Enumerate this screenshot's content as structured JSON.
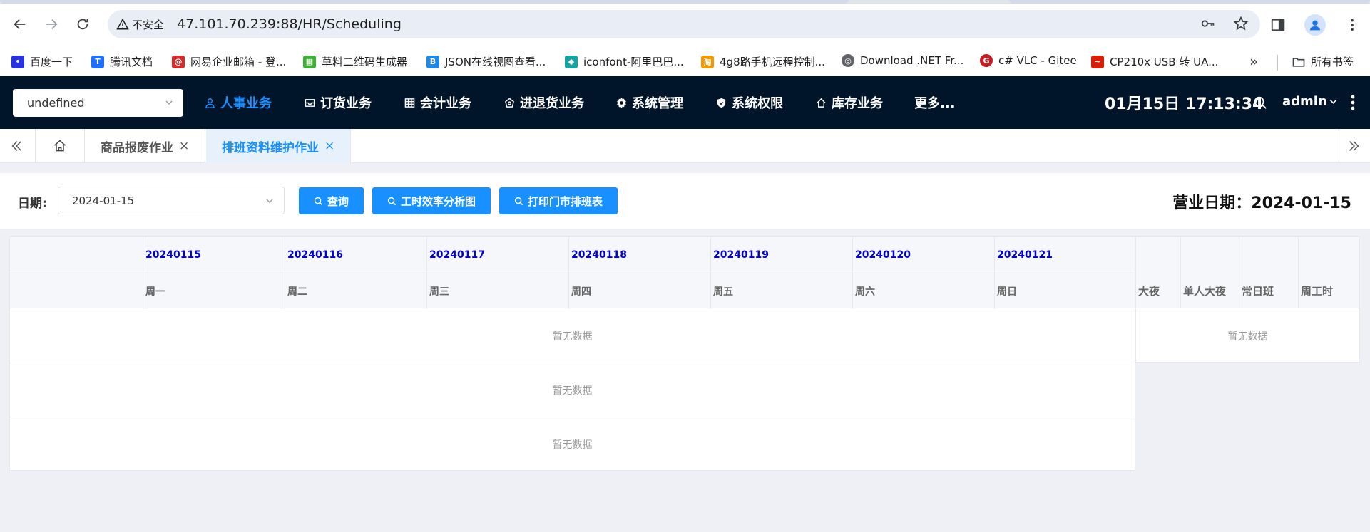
{
  "browser": {
    "security_label": "不安全",
    "url": "47.101.70.239:88/HR/Scheduling",
    "bookmarks": [
      {
        "label": "百度一下",
        "color": "#2932e1"
      },
      {
        "label": "腾讯文档",
        "color": "#1e6fff"
      },
      {
        "label": "网易企业邮箱 - 登...",
        "color": "#d52b2b"
      },
      {
        "label": "草料二维码生成器",
        "color": "#3cb034"
      },
      {
        "label": "JSON在线视图查看...",
        "color": "#1e88e5"
      },
      {
        "label": "iconfont-阿里巴巴...",
        "color": "#16a3a3"
      },
      {
        "label": "4g8路手机远程控制...",
        "color": "#f39800"
      },
      {
        "label": "Download .NET Fr...",
        "color": "#5f6368"
      },
      {
        "label": "c# VLC - Gitee",
        "color": "#c71d23"
      },
      {
        "label": "CP210x USB 转 UA...",
        "color": "#d81e06"
      }
    ],
    "all_bookmarks_label": "所有书签"
  },
  "header": {
    "org_select_value": "undefined",
    "menu": [
      {
        "label": "人事业务",
        "icon": "user-icon",
        "active": true
      },
      {
        "label": "订货业务",
        "icon": "mail-icon",
        "active": false
      },
      {
        "label": "会计业务",
        "icon": "table-icon",
        "active": false
      },
      {
        "label": "进退货业务",
        "icon": "shop-icon",
        "active": false
      },
      {
        "label": "系统管理",
        "icon": "gear-icon",
        "active": false
      },
      {
        "label": "系统权限",
        "icon": "shield-icon",
        "active": false
      },
      {
        "label": "库存业务",
        "icon": "home-icon",
        "active": false
      },
      {
        "label": "更多...",
        "icon": "",
        "active": false
      }
    ],
    "clock": "01月15日 17:13:34",
    "user": "admin"
  },
  "tabs": [
    {
      "label": "商品报废作业",
      "active": false
    },
    {
      "label": "排班资料维护作业",
      "active": true
    }
  ],
  "filter": {
    "date_label": "日期:",
    "date_value": "2024-01-15",
    "buttons": [
      "查询",
      "工时效率分析图",
      "打印门市排班表"
    ],
    "business_date": "营业日期：2024-01-15"
  },
  "schedule_table": {
    "dates": [
      "20240115",
      "20240116",
      "20240117",
      "20240118",
      "20240119",
      "20240120",
      "20240121"
    ],
    "weekdays": [
      "周一",
      "周二",
      "周三",
      "周四",
      "周五",
      "周六",
      "周日"
    ],
    "empty_text": "暂无数据",
    "side_columns": [
      "大夜",
      "单人大夜",
      "常日班",
      "周工时"
    ]
  }
}
